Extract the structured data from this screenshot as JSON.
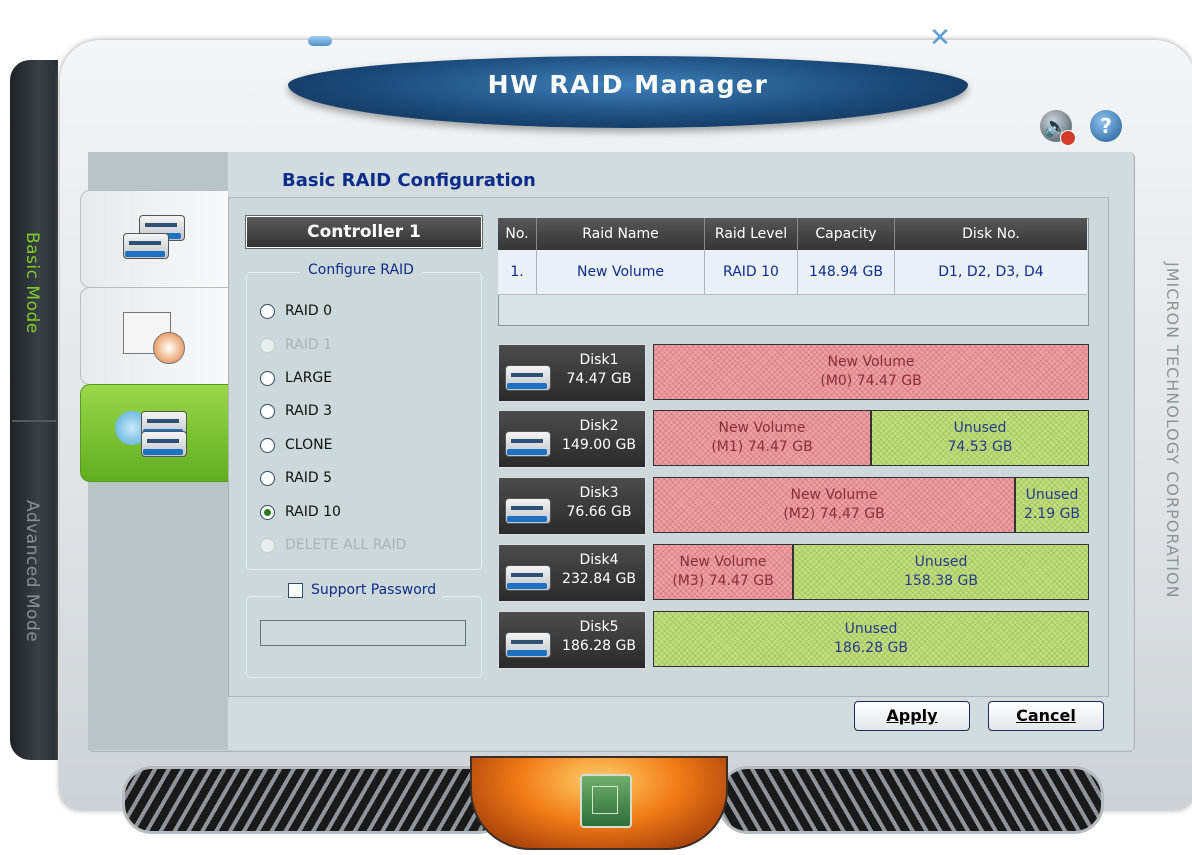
{
  "window": {
    "title": "HW RAID Manager",
    "minimize_icon": "minimize-icon",
    "close_icon": "close-icon",
    "corporation": "JMICRON TECHNOLOGY CORPORATION"
  },
  "modes": {
    "basic": "Basic Mode",
    "advanced": "Advanced Mode"
  },
  "icons": {
    "sound": "speaker-mute-icon",
    "help": "help-icon"
  },
  "page": {
    "heading": "Basic RAID Configuration",
    "controller": "Controller 1",
    "configure_legend": "Configure RAID"
  },
  "raid_options": [
    {
      "label": "RAID 0",
      "enabled": true,
      "checked": false
    },
    {
      "label": "RAID 1",
      "enabled": false,
      "checked": false
    },
    {
      "label": "LARGE",
      "enabled": true,
      "checked": false
    },
    {
      "label": "RAID 3",
      "enabled": true,
      "checked": false
    },
    {
      "label": "CLONE",
      "enabled": true,
      "checked": false
    },
    {
      "label": "RAID 5",
      "enabled": true,
      "checked": false
    },
    {
      "label": "RAID 10",
      "enabled": true,
      "checked": true
    },
    {
      "label": "DELETE ALL RAID",
      "enabled": false,
      "checked": false
    }
  ],
  "password": {
    "label": "Support Password",
    "checked": false,
    "value": ""
  },
  "table": {
    "headers": [
      "No.",
      "Raid Name",
      "Raid Level",
      "Capacity",
      "Disk No."
    ],
    "rows": [
      [
        "1.",
        "New Volume",
        "RAID 10",
        "148.94 GB",
        "D1, D2, D3, D4"
      ]
    ]
  },
  "disks": [
    {
      "name": "Disk1",
      "size": "74.47 GB",
      "segments": [
        {
          "type": "used",
          "line1": "New Volume",
          "line2": "(M0) 74.47 GB"
        }
      ]
    },
    {
      "name": "Disk2",
      "size": "149.00 GB",
      "segments": [
        {
          "type": "used",
          "line1": "New Volume",
          "line2": "(M1) 74.47 GB"
        },
        {
          "type": "unused",
          "line1": "Unused",
          "line2": "74.53 GB"
        }
      ]
    },
    {
      "name": "Disk3",
      "size": "76.66 GB",
      "segments": [
        {
          "type": "used",
          "line1": "New Volume",
          "line2": "(M2) 74.47 GB"
        },
        {
          "type": "unused",
          "line1": "Unused",
          "line2": "2.19 GB"
        }
      ]
    },
    {
      "name": "Disk4",
      "size": "232.84 GB",
      "segments": [
        {
          "type": "used",
          "line1": "New Volume",
          "line2": "(M3) 74.47 GB"
        },
        {
          "type": "unused",
          "line1": "Unused",
          "line2": "158.38 GB"
        }
      ]
    },
    {
      "name": "Disk5",
      "size": "186.28 GB",
      "segments": [
        {
          "type": "unused",
          "line1": "Unused",
          "line2": "186.28 GB"
        }
      ]
    }
  ],
  "buttons": {
    "apply": "Apply",
    "cancel": "Cancel"
  },
  "colors": {
    "used": "#ef9fa1",
    "unused": "#c0de7a",
    "heading": "#0c2d8a",
    "banner": "#1b4a7a"
  }
}
